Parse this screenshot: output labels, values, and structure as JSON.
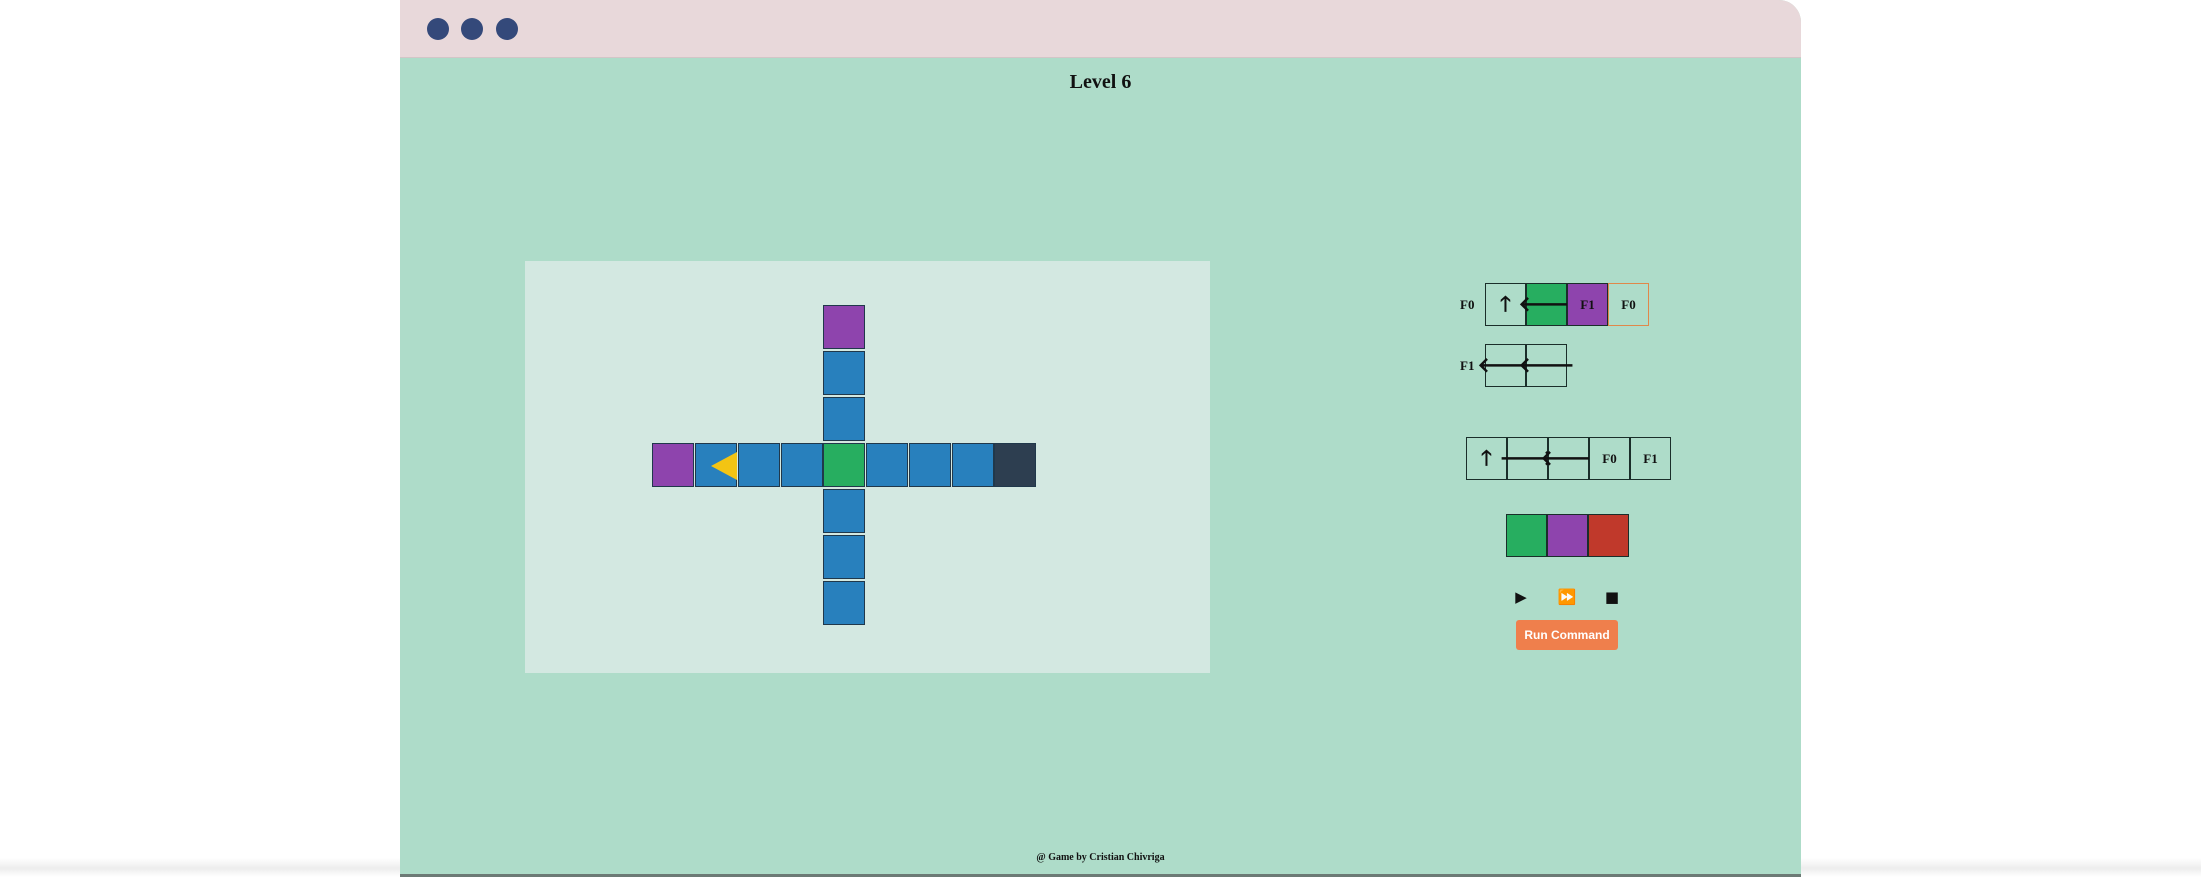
{
  "level": {
    "title": "Level 6"
  },
  "window_controls": [
    "window-dot-1",
    "window-dot-2",
    "window-dot-3"
  ],
  "board": {
    "cells": [
      {
        "color": "purple"
      },
      {
        "color": "blue",
        "robot": true,
        "robot_direction": "left"
      },
      {
        "color": "blue"
      },
      {
        "color": "blue"
      },
      {
        "color": "green"
      },
      {
        "color": "blue"
      },
      {
        "color": "blue"
      },
      {
        "color": "blue"
      },
      {
        "color": "dark"
      },
      {
        "color": "purple"
      },
      {
        "color": "blue"
      },
      {
        "color": "blue"
      },
      {
        "color": "blue"
      },
      {
        "color": "blue"
      },
      {
        "color": "blue"
      }
    ]
  },
  "functions": {
    "f0": {
      "label": "F0",
      "slots": [
        {
          "icon": "arrow-up-icon",
          "glyph": "🡑",
          "color": ""
        },
        {
          "icon": "arrow-left-icon",
          "glyph": "🡐",
          "color": "green"
        },
        {
          "text": "F1",
          "color": "purple"
        },
        {
          "text": "F0",
          "color": "",
          "active": true
        }
      ]
    },
    "f1": {
      "label": "F1",
      "slots": [
        {
          "icon": "arrow-left-icon",
          "glyph": "🡐",
          "color": ""
        },
        {
          "icon": "arrow-left-icon",
          "glyph": "🡐",
          "color": ""
        }
      ]
    }
  },
  "command_palette": [
    {
      "icon": "arrow-up-icon",
      "glyph": "🡑"
    },
    {
      "icon": "arrow-right-icon",
      "glyph": "🡒"
    },
    {
      "icon": "arrow-left-icon",
      "glyph": "🡐"
    },
    {
      "text": "F0"
    },
    {
      "text": "F1"
    }
  ],
  "color_palette": [
    "green",
    "purple",
    "red"
  ],
  "playback": {
    "play": {
      "icon": "play-icon",
      "glyph": "▶"
    },
    "fast_forward": {
      "icon": "fast-forward-icon",
      "glyph": "⏩"
    },
    "stop": {
      "icon": "stop-icon",
      "glyph": "■"
    }
  },
  "run_button": {
    "label": "Run Command"
  },
  "footer": {
    "text": "@ Game by Cristian Chivriga"
  }
}
